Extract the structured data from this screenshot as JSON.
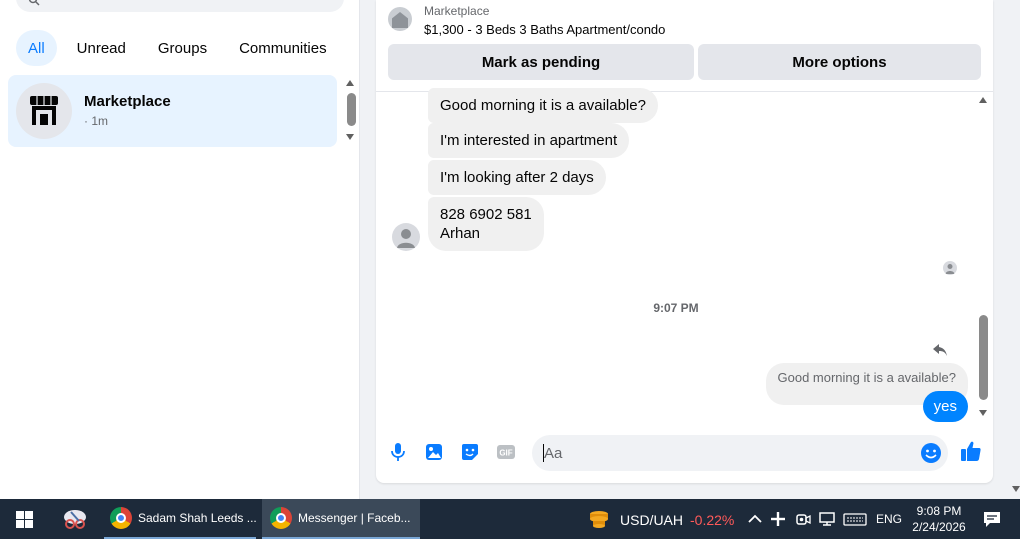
{
  "sidebar": {
    "filters": [
      "All",
      "Unread",
      "Groups",
      "Communities"
    ],
    "active_filter": "All",
    "conversations": [
      {
        "name": "Marketplace",
        "meta": "· 1m"
      }
    ]
  },
  "chat": {
    "listing": {
      "source": "Marketplace",
      "title": "$1,300 - 3 Beds 3 Baths Apartment/condo"
    },
    "actions": {
      "mark_pending": "Mark as pending",
      "more_options": "More options"
    },
    "messages": {
      "incoming": [
        "Good morning it is a available?",
        "I'm interested in apartment",
        "I'm looking after 2 days",
        {
          "line1": "828 6902 581",
          "line2": "Arhan"
        }
      ],
      "timestamp": "9:07 PM",
      "reply_quote": "Good morning it is a available?",
      "outgoing": "yes"
    },
    "composer": {
      "placeholder": "Aa"
    }
  },
  "taskbar": {
    "apps": [
      {
        "label": "Sadam Shah Leeds ...",
        "badge": "C"
      },
      {
        "label": "Messenger | Faceb..."
      }
    ],
    "currency_pair": "USD/UAH",
    "currency_change": "-0.22%",
    "language": "ENG",
    "time": "9:08 PM",
    "date": "2/24/2026"
  },
  "colors": {
    "accent": "#0a7cff",
    "outgoing_bubble": "#0084ff",
    "taskbar": "#1d2a3a",
    "negative": "#ff5a5a"
  }
}
